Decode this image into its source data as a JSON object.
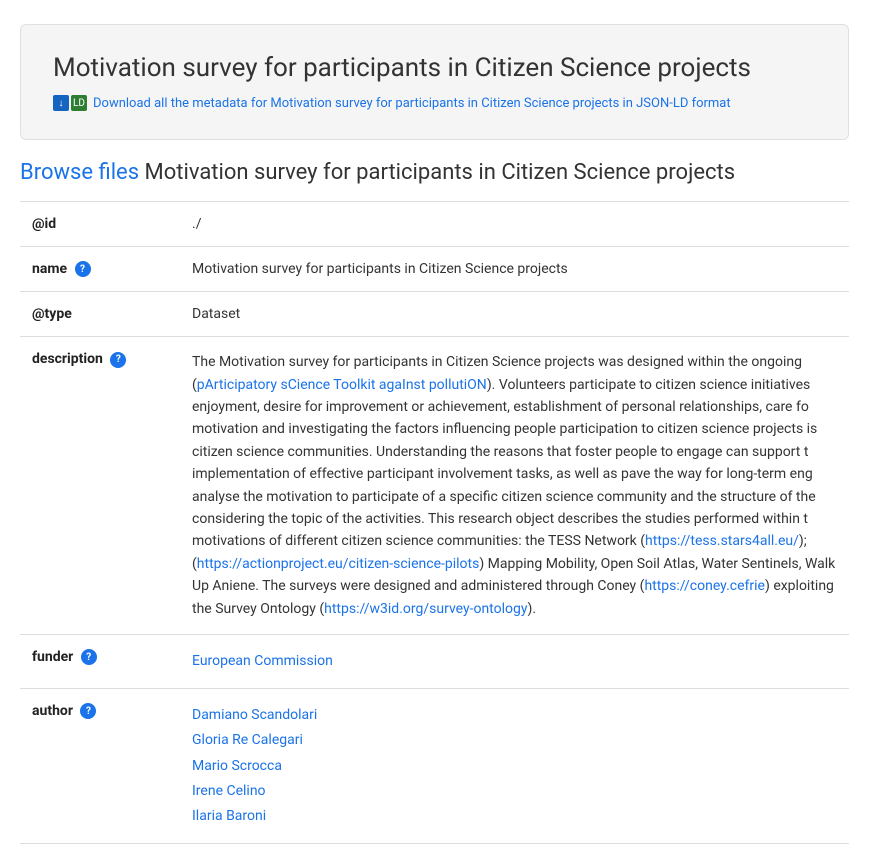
{
  "header": {
    "title": "Motivation survey for participants in Citizen Science projects",
    "download_link_text": "Download all the metadata for Motivation survey for participants in Citizen Science projects in JSON-LD format"
  },
  "browse_section": {
    "browse_label": "Browse files",
    "title": "Motivation survey for participants in Citizen Science projects"
  },
  "metadata": {
    "id_label": "@id",
    "id_value": "./",
    "name_label": "name",
    "name_help": "?",
    "name_value": "Motivation survey for participants in Citizen Science projects",
    "type_label": "@type",
    "type_value": "Dataset",
    "description_label": "description",
    "description_help": "?",
    "description_text": "The Motivation survey for participants in Citizen Science projects was designed within the ongoing (pArticipatory sCience Toolkit agaInst pollutiON). Volunteers participate to citizen science initiatives enjoyment, desire for improvement or achievement, establishment of personal relationships, care fo motivation and investigating the factors influencing people participation to citizen science projects is citizen science communities. Understanding the reasons that foster people to engage can support t implementation of effective participant involvement tasks, as well as pave the way for long-term eng analyse the motivation to participate of a specific citizen science community and the structure of the considering the topic of the activities. This research object describes the studies performed within t motivations of different citizen science communities: the TESS Network (https://tess.stars4all.eu/); (https://actionproject.eu/citizen-science-pilots) Mapping Mobility, Open Soil Atlas, Water Sentinels, Walk Up Aniene. The surveys were designed and administered through Coney (https://coney.cefrie exploiting the Survey Ontology (https://w3id.org/survey-ontology).",
    "funder_label": "funder",
    "funder_help": "?",
    "funder_value": "European Commission",
    "author_label": "author",
    "author_help": "?",
    "authors": [
      "Damiano Scandolari",
      "Gloria Re Calegari",
      "Mario Scrocca",
      "Irene Celino",
      "Ilaria Baroni"
    ]
  }
}
